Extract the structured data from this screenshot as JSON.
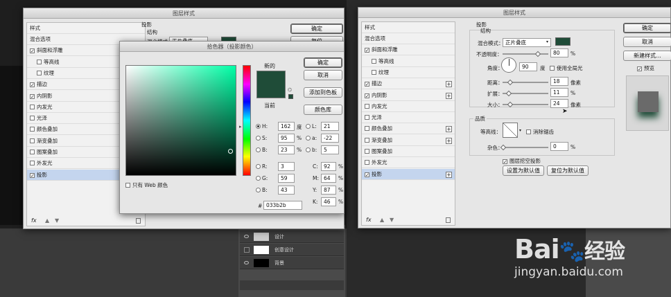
{
  "colors": {
    "picked_new": "#033b2b",
    "picked_current": "#1f4c38"
  },
  "left_dialog": {
    "title": "图层样式",
    "list_header": "样式",
    "items": [
      {
        "label": "混合选项",
        "checkbox": false,
        "checked": false,
        "plus": false
      },
      {
        "label": "斜面和浮雕",
        "checkbox": true,
        "checked": true,
        "plus": false
      },
      {
        "label": "等高线",
        "checkbox": true,
        "checked": false,
        "plus": false
      },
      {
        "label": "纹理",
        "checkbox": true,
        "checked": false,
        "plus": false
      },
      {
        "label": "描边",
        "checkbox": true,
        "checked": true,
        "plus": true
      },
      {
        "label": "内阴影",
        "checkbox": true,
        "checked": true,
        "plus": true
      },
      {
        "label": "内发光",
        "checkbox": true,
        "checked": false,
        "plus": false
      },
      {
        "label": "光泽",
        "checkbox": true,
        "checked": false,
        "plus": false
      },
      {
        "label": "颜色叠加",
        "checkbox": true,
        "checked": false,
        "plus": true
      },
      {
        "label": "渐变叠加",
        "checkbox": true,
        "checked": false,
        "plus": true
      },
      {
        "label": "图案叠加",
        "checkbox": true,
        "checked": false,
        "plus": false
      },
      {
        "label": "外发光",
        "checkbox": true,
        "checked": false,
        "plus": false
      },
      {
        "label": "投影",
        "checkbox": true,
        "checked": true,
        "plus": true
      }
    ],
    "section": "投影",
    "structure": "结构",
    "blend_label": "混合模式",
    "blend_value": "正片叠底",
    "ok": "确定",
    "reset": "复位",
    "fx": "fx"
  },
  "color_picker": {
    "title": "拾色器（投影颜色）",
    "new_label": "新的",
    "current_label": "当前",
    "ok": "确定",
    "cancel": "取消",
    "add_swatch": "添加到色板",
    "libraries": "颜色库",
    "web_only": "只有 Web 颜色",
    "fields": [
      {
        "label": "H:",
        "value": "162",
        "unit": "度",
        "radio": true,
        "checked": true
      },
      {
        "label": "S:",
        "value": "95",
        "unit": "%",
        "radio": true,
        "checked": false
      },
      {
        "label": "B:",
        "value": "23",
        "unit": "%",
        "radio": true,
        "checked": false
      },
      {
        "label": "R:",
        "value": "3",
        "unit": "",
        "radio": true,
        "checked": false
      },
      {
        "label": "G:",
        "value": "59",
        "unit": "",
        "radio": true,
        "checked": false
      },
      {
        "label": "B:",
        "value": "43",
        "unit": "",
        "radio": true,
        "checked": false
      }
    ],
    "lab_fields": [
      {
        "label": "L:",
        "value": "21"
      },
      {
        "label": "a:",
        "value": "-22"
      },
      {
        "label": "b:",
        "value": "5"
      }
    ],
    "cmyk_fields": [
      {
        "label": "C:",
        "value": "92",
        "unit": "%"
      },
      {
        "label": "M:",
        "value": "64",
        "unit": "%"
      },
      {
        "label": "Y:",
        "value": "87",
        "unit": "%"
      },
      {
        "label": "K:",
        "value": "46",
        "unit": "%"
      }
    ],
    "hex_label": "#",
    "hex": "033b2b"
  },
  "right_dialog": {
    "title": "图层样式",
    "list_header": "样式",
    "section": "投影",
    "structure": "结构",
    "blend_label": "混合模式：",
    "blend_value": "正片叠底",
    "opacity_label": "不透明度：",
    "opacity_value": "80",
    "angle_label": "角度：",
    "angle_value": "90",
    "angle_unit": "度",
    "global_light": "使用全局光",
    "distance_label": "距离：",
    "distance_value": "18",
    "spread_label": "扩展：",
    "spread_value": "11",
    "size_label": "大小：",
    "size_value": "24",
    "px": "像素",
    "percent": "%",
    "quality": "品质",
    "contour_label": "等高线：",
    "anti_alias": "消除锯齿",
    "noise_label": "杂色：",
    "noise_value": "0",
    "knockout": "图层挖空投影",
    "make_default": "设置为默认值",
    "reset_default": "复位为默认值",
    "ok": "确定",
    "cancel": "取消",
    "new_style": "新建样式...",
    "preview": "预览"
  },
  "layers": [
    {
      "name": "设计"
    },
    {
      "name": "创意设计"
    },
    {
      "name": "背景"
    }
  ],
  "watermark": {
    "brand": "Bai",
    "paw": "du",
    "suffix": "经验",
    "url": "jingyan.baidu.com"
  }
}
